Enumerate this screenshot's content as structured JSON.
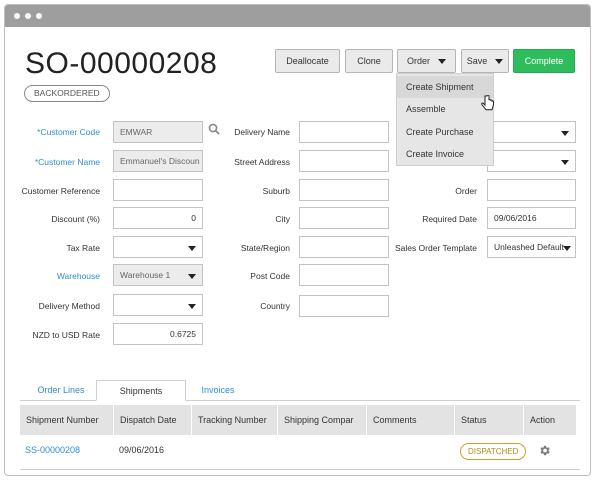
{
  "header": {
    "order_number": "SO-00000208",
    "status_badge": "BACKORDERED"
  },
  "toolbar": {
    "deallocate": "Deallocate",
    "clone": "Clone",
    "order": "Order",
    "save": "Save",
    "complete": "Complete"
  },
  "order_menu": {
    "items": [
      "Create Shipment",
      "Assemble",
      "Create Purchase",
      "Create Invoice"
    ]
  },
  "form": {
    "customer_code": {
      "label": "*Customer Code",
      "value": "EMWAR"
    },
    "customer_name": {
      "label": "*Customer Name",
      "value": "Emmanuel's Discoun"
    },
    "customer_reference": {
      "label": "Customer Reference",
      "value": ""
    },
    "discount": {
      "label": "Discount (%)",
      "value": "0"
    },
    "tax_rate": {
      "label": "Tax Rate",
      "value": ""
    },
    "warehouse": {
      "label": "Warehouse",
      "value": "Warehouse 1"
    },
    "delivery_method": {
      "label": "Delivery Method",
      "value": ""
    },
    "nzd_usd_rate": {
      "label": "NZD to USD Rate",
      "value": "0.6725"
    },
    "delivery_name": {
      "label": "Delivery Name",
      "value": ""
    },
    "street_address": {
      "label": "Street Address",
      "value": ""
    },
    "suburb": {
      "label": "Suburb",
      "value": ""
    },
    "city": {
      "label": "City",
      "value": ""
    },
    "state_region": {
      "label": "State/Region",
      "value": ""
    },
    "post_code": {
      "label": "Post Code",
      "value": ""
    },
    "country": {
      "label": "Country",
      "value": ""
    },
    "order": {
      "label": "Order",
      "value": ""
    },
    "required_date": {
      "label": "Required Date",
      "value": "09/06/2016"
    },
    "template": {
      "label": "Sales Order Template",
      "value": "Unleashed Default"
    }
  },
  "tabs": [
    "Order Lines",
    "Shipments",
    "Invoices"
  ],
  "shipments_table": {
    "columns": [
      "Shipment Number",
      "Dispatch Date",
      "Tracking Number",
      "Shipping Compar",
      "Comments",
      "Status",
      "Action"
    ],
    "rows": [
      {
        "shipment_number": "SS-00000208",
        "dispatch_date": "09/06/2016",
        "tracking_number": "",
        "shipping_company": "",
        "comments": "",
        "status": "DISPATCHED"
      }
    ]
  },
  "colors": {
    "accent_blue": "#2e8fd0",
    "complete_green": "#2ebd5c",
    "dispatched_gold": "#b08c12",
    "titlebar_gray": "#9e9e9e"
  }
}
